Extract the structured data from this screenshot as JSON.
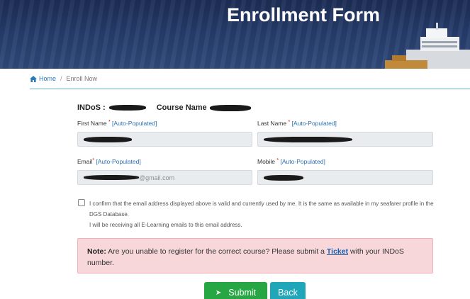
{
  "header": {
    "title": "Enrollment Form"
  },
  "breadcrumb": {
    "home_label": "Home",
    "separator": "/",
    "current": "Enroll Now",
    "home_icon": "home-icon"
  },
  "form": {
    "indos_label": "INDoS :",
    "course_label": "Course Name",
    "fields": {
      "first_name": {
        "label": "First Name",
        "required": "*",
        "auto": "[Auto-Populated]",
        "value": ""
      },
      "last_name": {
        "label": "Last Name",
        "required": "*",
        "auto": "[Auto-Populated]",
        "value": ""
      },
      "email": {
        "label": "Email",
        "required": "*",
        "auto": "[Auto-Populated]",
        "value": "",
        "visible_fragment": "@gmail.com"
      },
      "mobile": {
        "label": "Mobile",
        "required": "*",
        "auto": "[Auto-Populated]",
        "value": ""
      }
    },
    "confirm_text_1": "I confirm that the email address displayed above is valid and currently used by me. It is the same as available in my seafarer profile in the DGS Database.",
    "confirm_text_2": "I will be receiving all E-Learning emails to this email address.",
    "confirm_checked": false
  },
  "note": {
    "prefix": "Note:",
    "text_before": " Are you unable to register for the correct course? Please submit a ",
    "link": "Ticket",
    "text_after": " with your INDoS number."
  },
  "actions": {
    "submit_label": "Submit",
    "back_label": "Back"
  },
  "colors": {
    "header_bg": "#263c6b",
    "accent": "#2a7ab8",
    "submit": "#27a744",
    "back": "#1fa6b8",
    "note_bg": "#f8d7da"
  }
}
